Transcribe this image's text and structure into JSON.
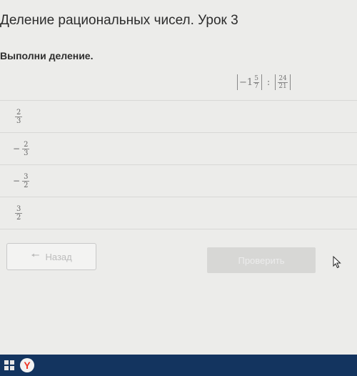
{
  "header": {
    "title": "Деление рациональных чисел. Урок 3"
  },
  "task": {
    "prompt": "Выполни деление.",
    "expression": {
      "left_sign": "−",
      "left_whole": "1",
      "left_num": "5",
      "left_den": "7",
      "operator": ":",
      "right_num": "24",
      "right_den": "21"
    }
  },
  "options": [
    {
      "sign": "",
      "num": "2",
      "den": "3"
    },
    {
      "sign": "−",
      "num": "2",
      "den": "3"
    },
    {
      "sign": "−",
      "num": "3",
      "den": "2"
    },
    {
      "sign": "",
      "num": "3",
      "den": "2"
    }
  ],
  "nav": {
    "back_label": "Назад",
    "next_label": "Проверить"
  },
  "taskbar": {
    "browser_icon": "yandex-browser-icon",
    "browser_letter": "Y"
  },
  "colors": {
    "taskbar": "#13345f",
    "page_bg": "#ececea"
  }
}
